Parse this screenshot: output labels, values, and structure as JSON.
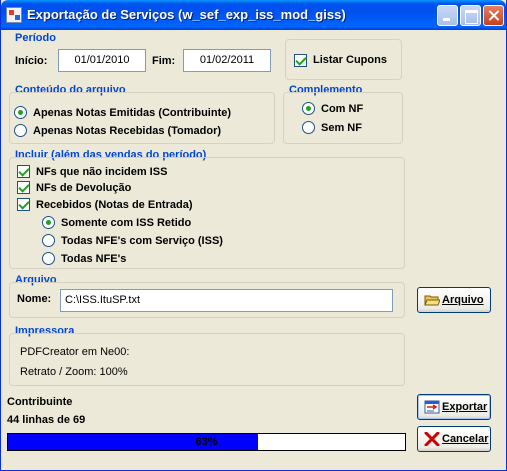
{
  "window": {
    "title": "Exportação de Serviços (w_sef_exp_iss_mod_giss)"
  },
  "periodo": {
    "title": "Período",
    "inicio_label": "Início:",
    "inicio_value": "01/01/2010",
    "fim_label": "Fim:",
    "fim_value": "01/02/2011",
    "listar_cupons_label": "Listar Cupons",
    "listar_cupons_checked": true
  },
  "conteudo": {
    "title": "Conteúdo do arquivo",
    "options": [
      {
        "label": "Apenas Notas Emitidas (Contribuinte)",
        "checked": true
      },
      {
        "label": "Apenas Notas Recebidas (Tomador)",
        "checked": false
      }
    ]
  },
  "complemento": {
    "title": "Complemento",
    "options": [
      {
        "label": "Com NF",
        "checked": true
      },
      {
        "label": "Sem NF",
        "checked": false
      }
    ]
  },
  "incluir": {
    "title": "Incluir (além das vendas do período)",
    "checks": [
      {
        "label": "NFs que não incidem ISS",
        "checked": true
      },
      {
        "label": "NFs de Devolução",
        "checked": true
      },
      {
        "label": "Recebidos (Notas de Entrada)",
        "checked": true
      }
    ],
    "radios": [
      {
        "label": "Somente com ISS Retido",
        "checked": true
      },
      {
        "label": "Todas NFE's com Serviço (ISS)",
        "checked": false
      },
      {
        "label": "Todas NFE's",
        "checked": false
      }
    ]
  },
  "arquivo": {
    "title": "Arquivo",
    "nome_label": "Nome:",
    "nome_value": "C:\\ISS.ItuSP.txt",
    "button_label": "Arquivo"
  },
  "impressora": {
    "title": "Impressora",
    "line1": "PDFCreator em Ne00:",
    "line2": "Retrato / Zoom: 100%"
  },
  "status": {
    "title": "Contribuinte",
    "lines": "44 linhas de 69",
    "progress_text": "63%",
    "progress_fraction": 0.63
  },
  "buttons": {
    "exportar": "Exportar",
    "cancelar": "Cancelar"
  },
  "colors": {
    "titlebar": "#0054e3",
    "group_title": "#0046d5",
    "progress_fill": "#0000ff",
    "check_mark": "#21a121",
    "cancel_icon": "#cc0000"
  }
}
